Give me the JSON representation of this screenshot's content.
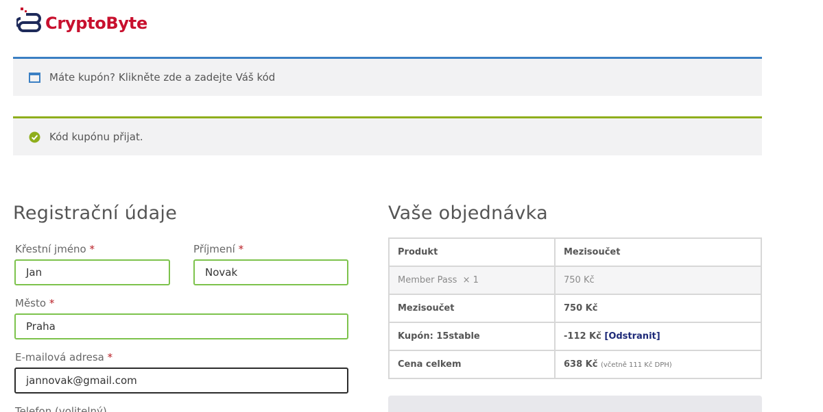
{
  "header": {
    "logo_text": "CryptoByte",
    "brand_color": "#c8102e",
    "logo_icon": "chain-link-icon"
  },
  "notices": {
    "coupon_prompt": "Máte kupón?",
    "coupon_link": "Klikněte zde a zadejte Váš kód",
    "coupon_applied": "Kód kupónu přijat.",
    "info_color": "#3a7fc3",
    "success_color": "#8fae1b"
  },
  "billing": {
    "title": "Registrační údaje",
    "required_mark": "*",
    "first_name": {
      "label": "Křestní jméno",
      "value": "Jan"
    },
    "last_name": {
      "label": "Příjmení",
      "value": "Novak"
    },
    "city": {
      "label": "Město",
      "value": "Praha"
    },
    "email": {
      "label": "E-mailová adresa",
      "value": "jannovak@gmail.com"
    },
    "phone": {
      "label": "Telefon (volitelný)"
    }
  },
  "order": {
    "title": "Vaše objednávka",
    "columns": [
      "Produkt",
      "Mezisoučet"
    ],
    "item": {
      "name": "Member Pass",
      "qty": "× 1",
      "price": "750 Kč"
    },
    "subtotal": {
      "label": "Mezisoučet",
      "value": "750 Kč"
    },
    "coupon": {
      "label": "Kupón: 15stable",
      "value": "-112 Kč",
      "remove": "[Odstranit]"
    },
    "total": {
      "label": "Cena celkem",
      "value": "638 Kč",
      "tax_note": "(včetně 111 Kč DPH)"
    }
  }
}
